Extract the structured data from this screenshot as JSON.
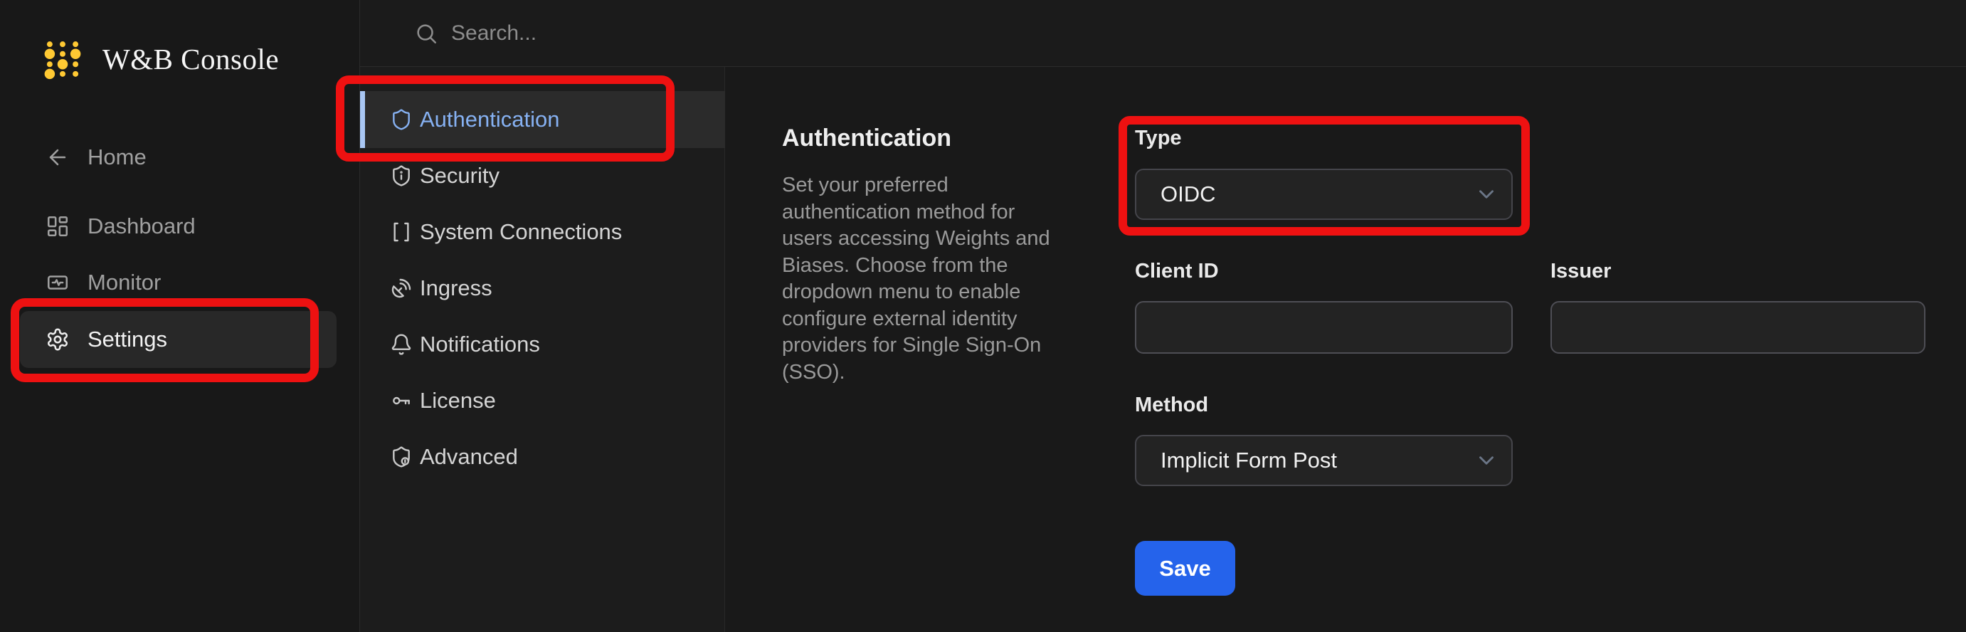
{
  "app": {
    "title": "W&B Console"
  },
  "header": {
    "search_placeholder": "Search..."
  },
  "sidebar": {
    "items": [
      {
        "label": "Home",
        "icon": "arrow-left-icon",
        "active": false
      },
      {
        "label": "Dashboard",
        "icon": "dashboard-icon",
        "active": false
      },
      {
        "label": "Monitor",
        "icon": "monitor-icon",
        "active": false
      },
      {
        "label": "Settings",
        "icon": "gear-icon",
        "active": true
      }
    ]
  },
  "settings_nav": {
    "items": [
      {
        "label": "Authentication",
        "icon": "shield-icon",
        "active": true
      },
      {
        "label": "Security",
        "icon": "shield-info-icon",
        "active": false
      },
      {
        "label": "System Connections",
        "icon": "brackets-icon",
        "active": false
      },
      {
        "label": "Ingress",
        "icon": "antenna-icon",
        "active": false
      },
      {
        "label": "Notifications",
        "icon": "bell-icon",
        "active": false
      },
      {
        "label": "License",
        "icon": "key-icon",
        "active": false
      },
      {
        "label": "Advanced",
        "icon": "shield-gear-icon",
        "active": false
      }
    ]
  },
  "main": {
    "section_title": "Authentication",
    "section_description": "Set your preferred authentication method for users accessing Weights and Biases. Choose from the dropdown menu to enable configure external identity providers for Single Sign-On (SSO).",
    "form": {
      "type": {
        "label": "Type",
        "value": "OIDC"
      },
      "client_id": {
        "label": "Client ID",
        "value": ""
      },
      "issuer": {
        "label": "Issuer",
        "value": ""
      },
      "method": {
        "label": "Method",
        "value": "Implicit Form Post"
      },
      "save_label": "Save"
    }
  },
  "annotations": {
    "color": "#ee1111",
    "highlighted": [
      "Settings",
      "Authentication",
      "Type"
    ]
  },
  "colors": {
    "accent_blue": "#86b1f2",
    "accent_bar_blue": "#a9c7f4",
    "save_blue": "#2563eb",
    "logo_yellow": "#ffc933",
    "annotation_red": "#ee1111"
  }
}
